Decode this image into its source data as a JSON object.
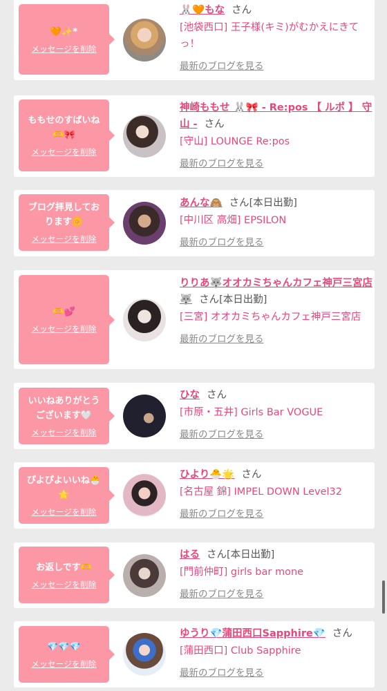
{
  "delete_label": "メッセージを削除",
  "blog_label": "最新のブログを見る",
  "san_label": "さん",
  "colors": {
    "bubble": "#fc98a6",
    "accent": "#e8477a",
    "muted": "#8a8a8a",
    "background": "#ebebeb"
  },
  "items": [
    {
      "message": "🧡✨*",
      "name": "🐰🧡もな",
      "status": "",
      "shop": "[池袋西口] 王子様(キミ)がむかえにきてっ！"
    },
    {
      "message": "ももせのすばいね\n🫶🎀",
      "name": "神崎ももせ 🐰🎀 - Re:pos 【 ルポ 】 守山 -",
      "status": "",
      "shop": "[守山] LOUNGE Re:pos"
    },
    {
      "message": "ブログ拝見してお\nります🌼",
      "name": "あんな🙈",
      "status": "[本日出勤]",
      "shop": "[中川区 高畑] EPSILON"
    },
    {
      "message": "🫶💕",
      "name": "りりあ🐺オオカミちゃんカフェ神戸三宮店🐺",
      "status": "[本日出勤]",
      "shop": "[三宮] オオカミちゃんカフェ神戸三宮店"
    },
    {
      "message": "いいねありがとう\nございます🤍",
      "name": "ひな",
      "status": "",
      "shop": "[市原・五井] Girls Bar VOGUE"
    },
    {
      "message": "ぴよぴよいいね🐣\n🌟",
      "name": "ひより🐣🌟",
      "status": "",
      "shop": "[名古屋 錦] IMPEL DOWN Level32"
    },
    {
      "message": "お返しです🫶",
      "name": "はる",
      "status": "[本日出勤]",
      "shop": "[門前仲町] girls bar mone"
    },
    {
      "message": "💎💎💎",
      "name": "ゆうり💎蒲田西口Sapphire💎",
      "status": "",
      "shop": "[蒲田西口] Club Sapphire"
    }
  ]
}
